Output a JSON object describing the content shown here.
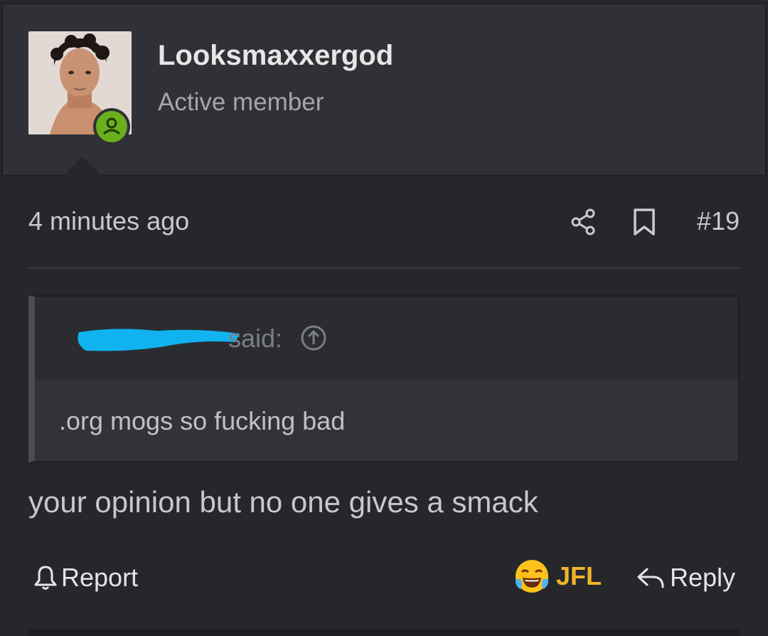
{
  "user": {
    "name": "Looksmaxxergod",
    "title": "Active member",
    "online_color": "#6ab01c"
  },
  "post": {
    "time": "4 minutes ago",
    "number": "#19",
    "icons": [
      "share-icon",
      "bookmark-icon"
    ]
  },
  "quote": {
    "said": "said:",
    "body": ".org mogs so fucking bad",
    "redaction_color": "#10b3f0"
  },
  "message": "your opinion but no one gives a smack",
  "actions": {
    "report": "Report",
    "reaction": "JFL",
    "reply": "Reply"
  },
  "colors": {
    "background": "#25272b",
    "header_bg": "#2f3136",
    "reaction": "#f0b429"
  }
}
